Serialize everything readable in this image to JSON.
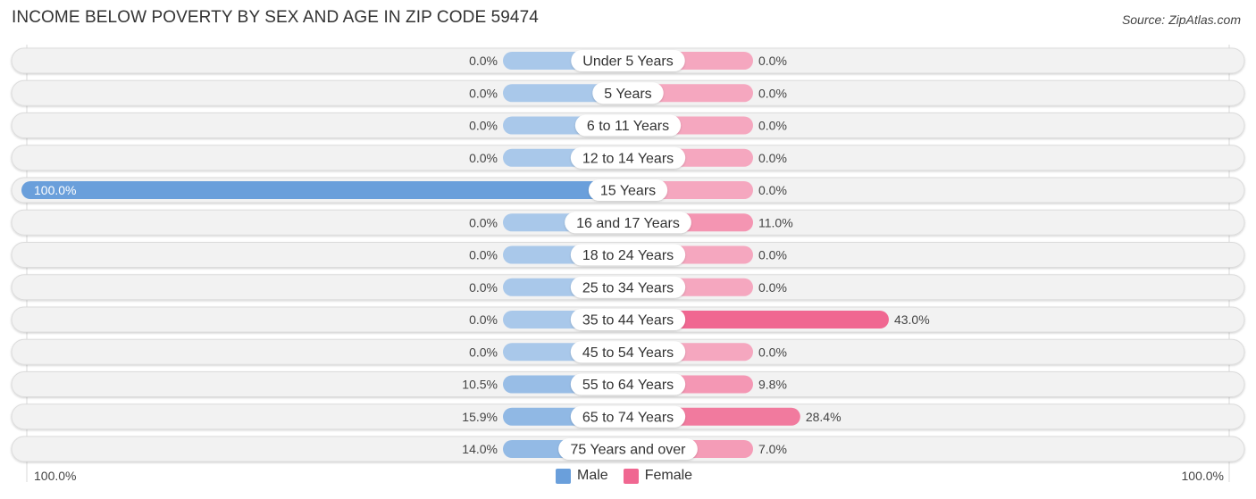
{
  "header": {
    "title": "INCOME BELOW POVERTY BY SEX AND AGE IN ZIP CODE 59474",
    "source": "Source: ZipAtlas.com"
  },
  "colors": {
    "male": "#6a9fdb",
    "male_light": "#a9c8ea",
    "female": "#f06791",
    "female_light": "#f5a7bf",
    "track": "#f2f2f2"
  },
  "legend": [
    {
      "label": "Male",
      "color": "#6a9fdb"
    },
    {
      "label": "Female",
      "color": "#f06791"
    }
  ],
  "axis": {
    "left_label": "100.0%",
    "right_label": "100.0%"
  },
  "chart_data": {
    "type": "bar",
    "orientation": "horizontal-diverging",
    "title": "INCOME BELOW POVERTY BY SEX AND AGE IN ZIP CODE 59474",
    "xlim": [
      -100,
      100
    ],
    "categories": [
      "Under 5 Years",
      "5 Years",
      "6 to 11 Years",
      "12 to 14 Years",
      "15 Years",
      "16 and 17 Years",
      "18 to 24 Years",
      "25 to 34 Years",
      "35 to 44 Years",
      "45 to 54 Years",
      "55 to 64 Years",
      "65 to 74 Years",
      "75 Years and over"
    ],
    "series": [
      {
        "name": "Male",
        "values": [
          0.0,
          0.0,
          0.0,
          0.0,
          100.0,
          0.0,
          0.0,
          0.0,
          0.0,
          0.0,
          10.5,
          15.9,
          14.0
        ],
        "labels": [
          "0.0%",
          "0.0%",
          "0.0%",
          "0.0%",
          "100.0%",
          "0.0%",
          "0.0%",
          "0.0%",
          "0.0%",
          "0.0%",
          "10.5%",
          "15.9%",
          "14.0%"
        ]
      },
      {
        "name": "Female",
        "values": [
          0.0,
          0.0,
          0.0,
          0.0,
          0.0,
          11.0,
          0.0,
          0.0,
          43.0,
          0.0,
          9.8,
          28.4,
          7.0
        ],
        "labels": [
          "0.0%",
          "0.0%",
          "0.0%",
          "0.0%",
          "0.0%",
          "11.0%",
          "0.0%",
          "0.0%",
          "43.0%",
          "0.0%",
          "9.8%",
          "28.4%",
          "7.0%"
        ]
      }
    ],
    "legend_position": "bottom-center",
    "grid": false
  }
}
